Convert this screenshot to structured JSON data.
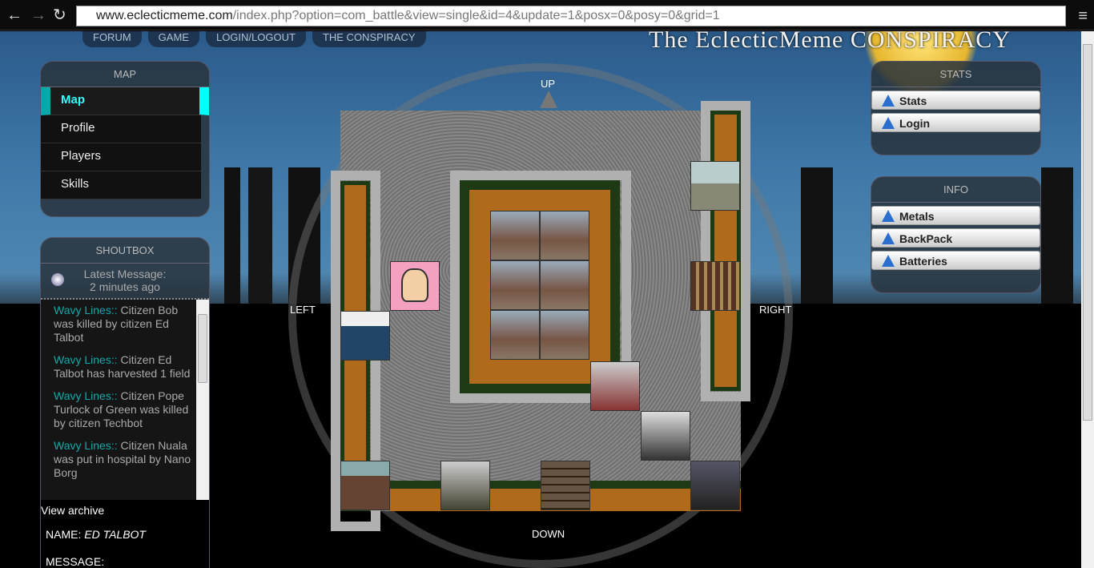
{
  "browser": {
    "url_host": "www.eclecticmeme.com",
    "url_path": "/index.php?option=com_battle&view=single&id=4&update=1&posx=0&posy=0&grid=1"
  },
  "topnav": [
    "FORUM",
    "GAME",
    "LOGIN/LOGOUT",
    "THE CONSPIRACY"
  ],
  "logo": "The EclecticMeme CONSPIRACY",
  "map_panel": {
    "title": "MAP",
    "items": [
      "Map",
      "Profile",
      "Players",
      "Skills"
    ]
  },
  "shoutbox": {
    "title": "SHOUTBOX",
    "latest": "Latest Message:",
    "ago": "2 minutes ago",
    "messages": [
      {
        "user": "Wavy Lines::",
        "text": " Citizen Bob was killed by citizen Ed Talbot"
      },
      {
        "user": "Wavy Lines::",
        "text": " Citizen Ed Talbot has harvested 1 field"
      },
      {
        "user": "Wavy Lines::",
        "text": " Citizen Pope Turlock of Green was killed by citizen Techbot"
      },
      {
        "user": "Wavy Lines::",
        "text": " Citizen Nuala was put in hospital by Nano Borg"
      }
    ],
    "archive": "View archive",
    "name_label": "NAME:",
    "name_value": "ED TALBOT",
    "message_label": "MESSAGE:"
  },
  "directions": {
    "up": "UP",
    "down": "DOWN",
    "left": "LEFT",
    "right": "RIGHT"
  },
  "stats_panel": {
    "title": "STATS",
    "items": [
      "Stats",
      "Login"
    ]
  },
  "info_panel": {
    "title": "INFO",
    "items": [
      "Metals",
      "BackPack",
      "Batteries"
    ]
  },
  "colors": {
    "accent": "#00ffff",
    "shout_user": "#11aaaa",
    "button_icon": "#2a6fd0"
  }
}
